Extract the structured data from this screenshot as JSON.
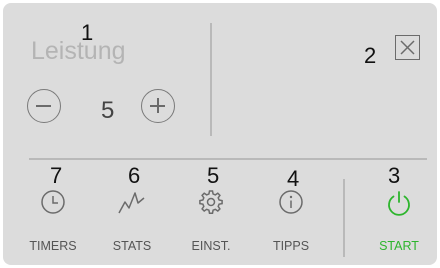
{
  "panel": {
    "title": "Leistung",
    "value": "5",
    "callout_labels": [
      "1",
      "2",
      "3",
      "4",
      "5",
      "6",
      "7"
    ]
  },
  "nav": [
    {
      "label": "TIMERS",
      "icon": "clock-icon"
    },
    {
      "label": "STATS",
      "icon": "stats-zigzag-icon"
    },
    {
      "label": "EINST.",
      "icon": "gear-icon"
    },
    {
      "label": "TIPPS",
      "icon": "info-icon"
    },
    {
      "label": "START",
      "icon": "power-icon"
    }
  ],
  "colors": {
    "background": "#dcdcdc",
    "icon_gray": "#6b6b6b",
    "start_green": "#2db52d"
  }
}
